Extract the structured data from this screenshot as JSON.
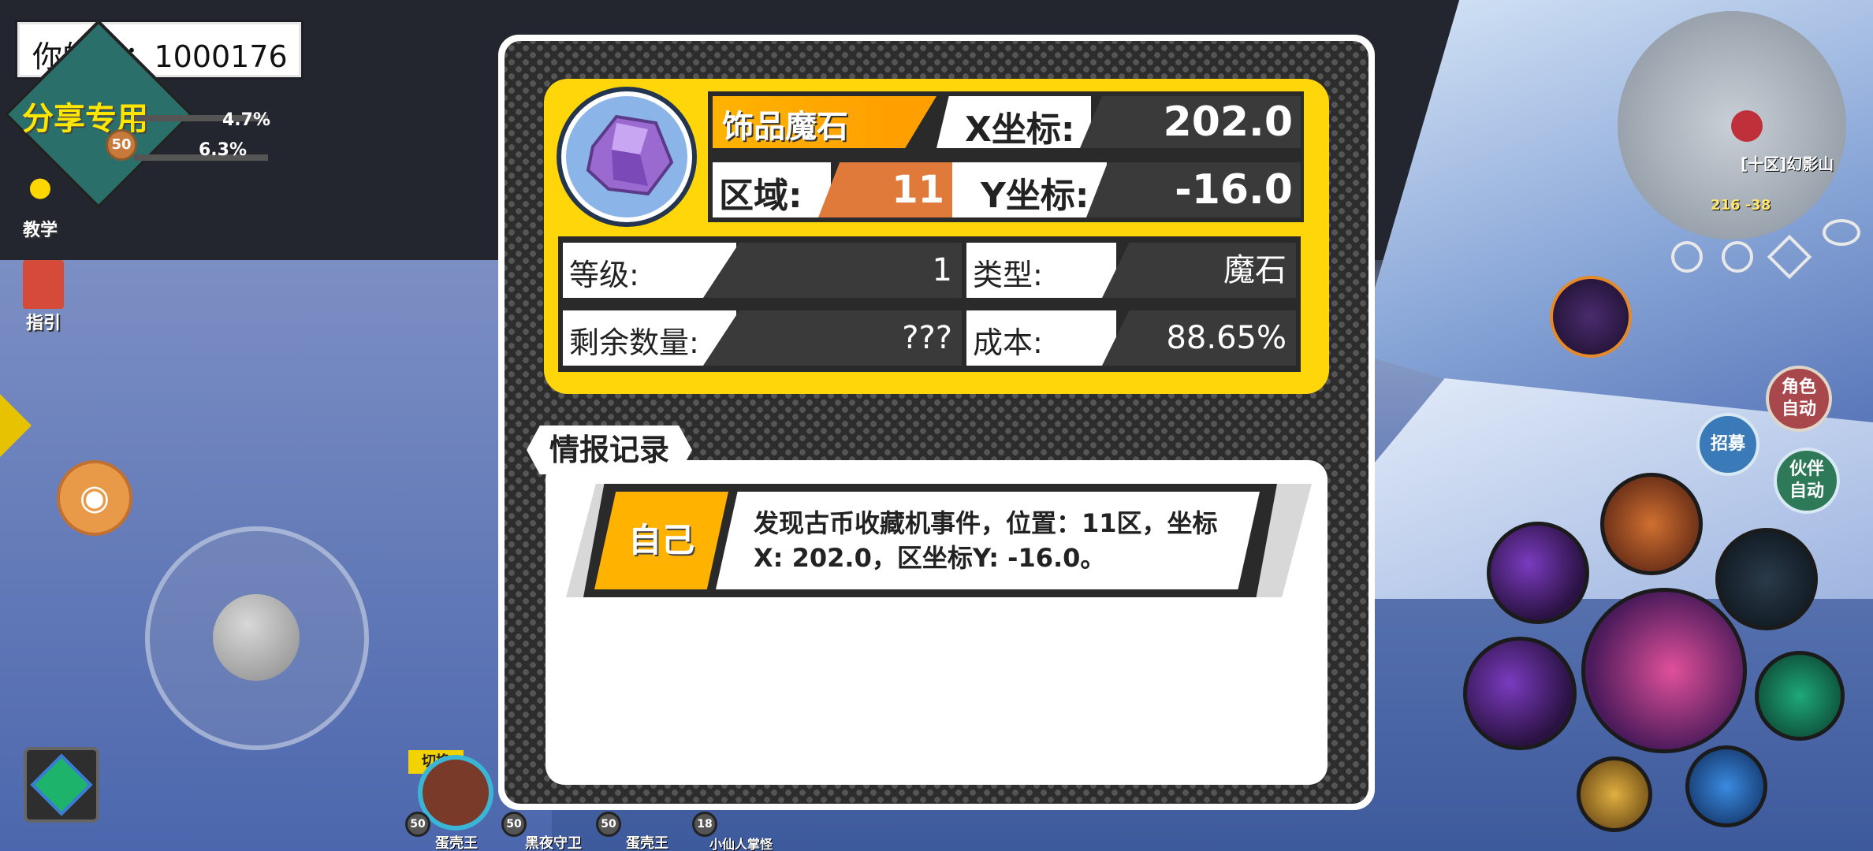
{
  "hud": {
    "player_id": "你的ID：1000176",
    "share_tag": "分享专用",
    "level_badge": "50",
    "stat_1": "4.7%",
    "stat_2": "6.3%",
    "menu_tutorial": "教学",
    "menu_guide": "指引",
    "bottom_switch": "切换"
  },
  "party": [
    {
      "level": "50",
      "name": "蛋壳王"
    },
    {
      "level": "50",
      "name": "黑夜守卫"
    },
    {
      "level": "50",
      "name": "蛋壳王"
    },
    {
      "level": "18",
      "name": "小仙人掌怪"
    }
  ],
  "minimap": {
    "zone_label": "[十区]幻影山",
    "coords": "216 -38"
  },
  "right_buttons": {
    "role_auto": "角色自动",
    "partner_auto": "伙伴自动",
    "recruit": "招募"
  },
  "info": {
    "item_name": "饰品魔石",
    "x_label": "X坐标:",
    "x_value": "202.0",
    "zone_label": "区域:",
    "zone_value": "11",
    "y_label": "Y坐标:",
    "y_value": "-16.0",
    "level_label": "等级:",
    "level_value": "1",
    "type_label": "类型:",
    "type_value": "魔石",
    "remain_label": "剩余数量:",
    "remain_value": "???",
    "cost_label": "成本:",
    "cost_value": "88.65%"
  },
  "log": {
    "tab_title": "情报记录",
    "entries": [
      {
        "who": "自己",
        "text": "发现古币收藏机事件，位置：11区，坐标X: 202.0，区坐标Y: -16.0。"
      }
    ]
  },
  "colors": {
    "card_yellow": "#ffd60a",
    "name_orange": "#ffb300",
    "zone_orange": "#e07a3a",
    "dark_cell": "#3a3a3a"
  }
}
